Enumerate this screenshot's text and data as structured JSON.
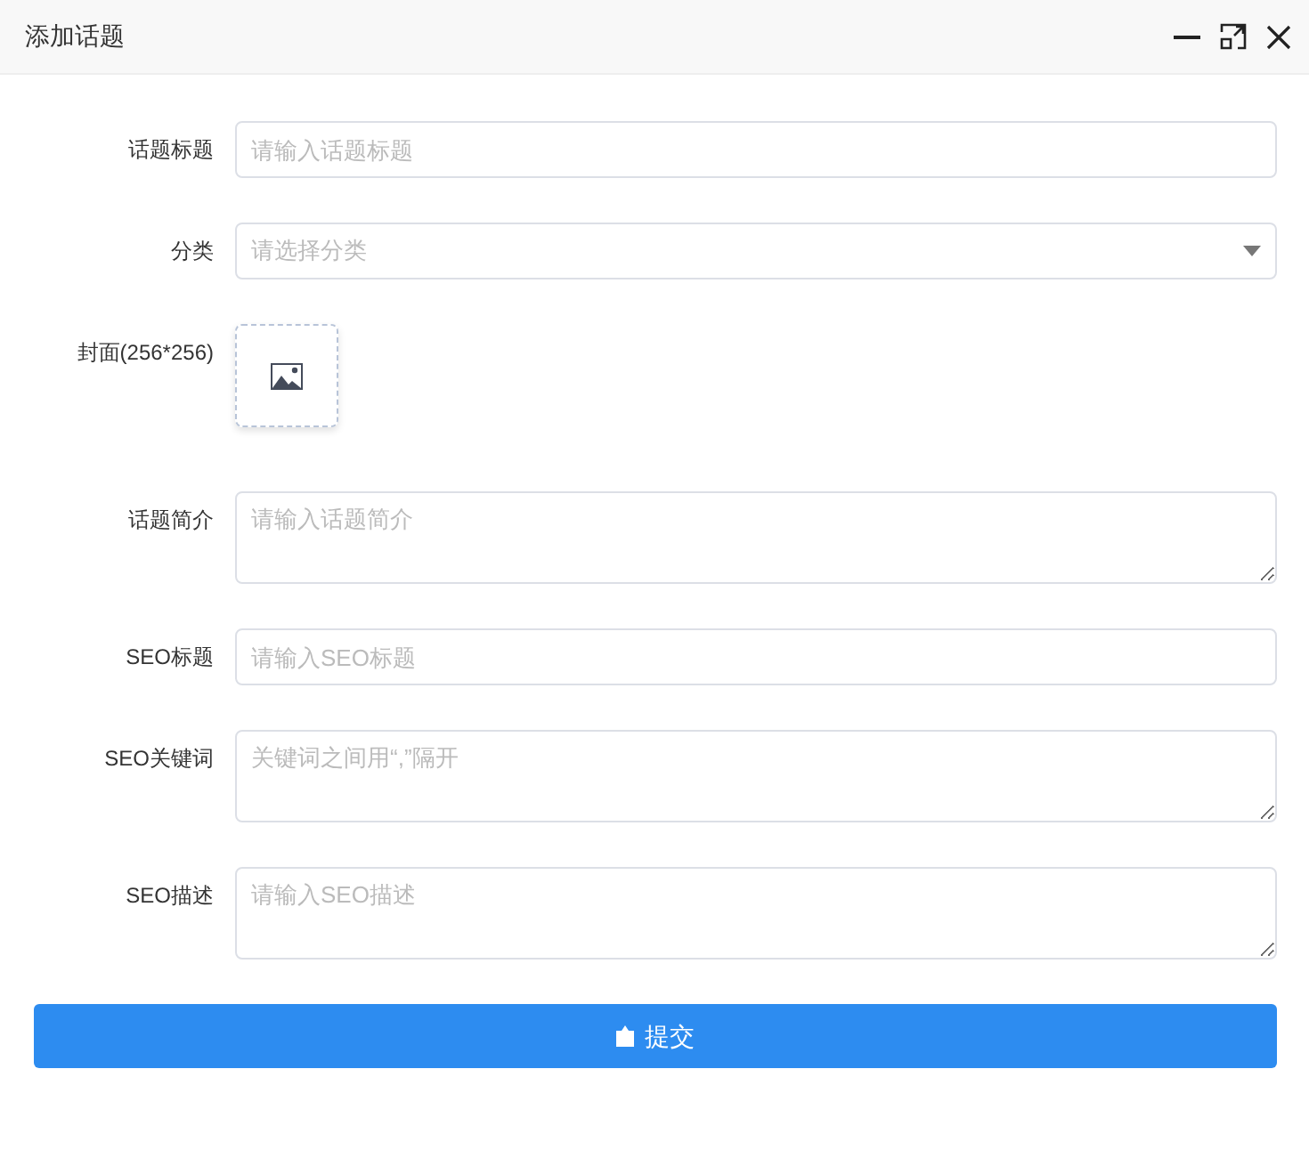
{
  "window": {
    "title": "添加话题"
  },
  "fields": [
    {
      "kind": "text",
      "label": "话题标题",
      "placeholder": "请输入话题标题"
    },
    {
      "kind": "select",
      "label": "分类",
      "placeholder": "请选择分类"
    },
    {
      "kind": "upload",
      "label": "封面(256*256)"
    },
    {
      "kind": "textarea",
      "label": "话题简介",
      "placeholder": "请输入话题简介"
    },
    {
      "kind": "text",
      "label": "SEO标题",
      "placeholder": "请输入SEO标题"
    },
    {
      "kind": "textarea",
      "label": "SEO关键词",
      "placeholder": "关键词之间用“,”隔开"
    },
    {
      "kind": "textarea",
      "label": "SEO描述",
      "placeholder": "请输入SEO描述"
    }
  ],
  "submit": {
    "label": "提交"
  }
}
